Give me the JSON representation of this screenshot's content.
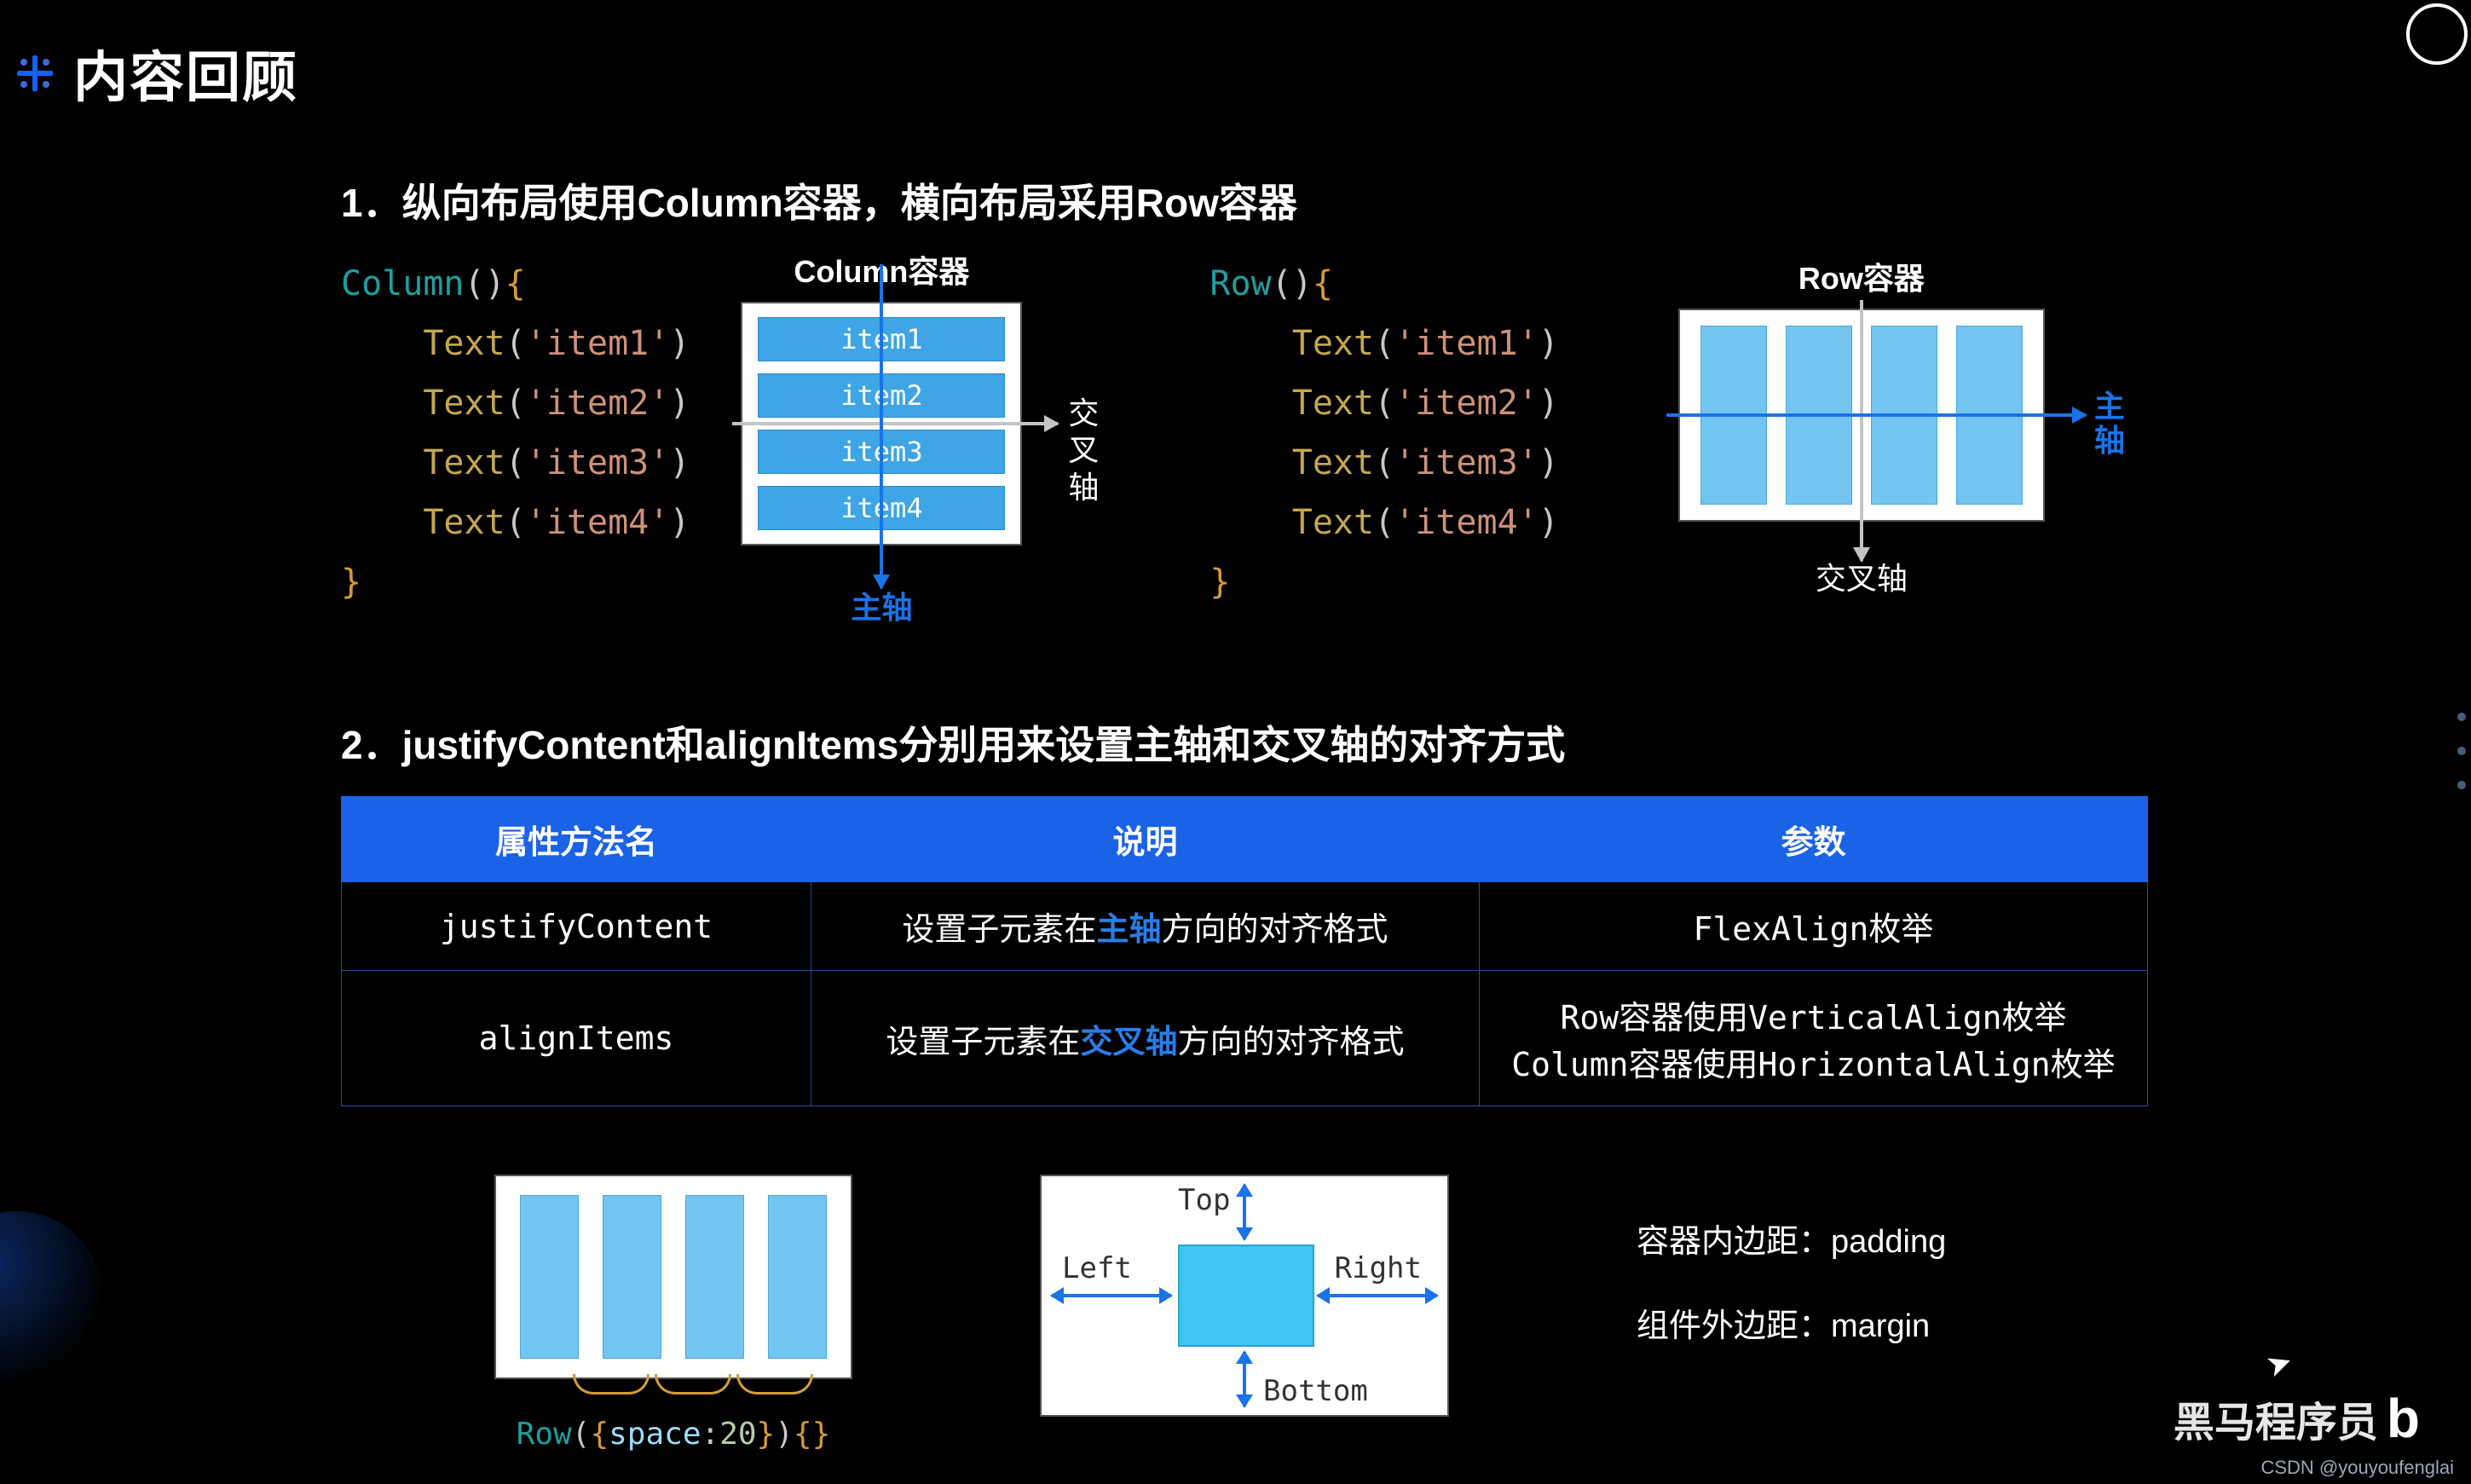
{
  "title": "内容回顾",
  "section1": {
    "heading": "1．纵向布局使用Column容器，横向布局采用Row容器",
    "columnCode": {
      "open": "Column(){",
      "items": [
        "Text('item1')",
        "Text('item2')",
        "Text('item3')",
        "Text('item4')"
      ],
      "close": "}"
    },
    "columnDiagram": {
      "title": "Column容器",
      "items": [
        "item1",
        "item2",
        "item3",
        "item4"
      ],
      "mainAxis": "主轴",
      "crossAxis": "交叉轴"
    },
    "rowCode": {
      "open": "Row(){",
      "items": [
        "Text('item1')",
        "Text('item2')",
        "Text('item3')",
        "Text('item4')"
      ],
      "close": "}"
    },
    "rowDiagram": {
      "title": "Row容器",
      "mainAxis": "主轴",
      "crossAxis": "交叉轴"
    }
  },
  "section2": {
    "heading": "2．justifyContent和alignItems分别用来设置主轴和交叉轴的对齐方式",
    "table": {
      "headers": [
        "属性方法名",
        "说明",
        "参数"
      ],
      "rows": [
        {
          "name": "justifyContent",
          "descPrefix": "设置子元素在",
          "descHl": "主轴",
          "descSuffix": "方向的对齐格式",
          "param": "FlexAlign枚举"
        },
        {
          "name": "alignItems",
          "descPrefix": "设置子元素在",
          "descHl": "交叉轴",
          "descSuffix": "方向的对齐格式",
          "paramLine1": "Row容器使用VerticalAlign枚举",
          "paramLine2": "Column容器使用HorizontalAlign枚举"
        }
      ]
    }
  },
  "section3": {
    "spaceCode": "Row({space:20}){}",
    "padding": {
      "top": "Top",
      "bottom": "Bottom",
      "left": "Left",
      "right": "Right"
    },
    "textPadding": "容器内边距：padding",
    "textMargin": "组件外边距：margin"
  },
  "footer": {
    "brand": "黑马程序员",
    "credit": "CSDN @youyoufenglai"
  }
}
